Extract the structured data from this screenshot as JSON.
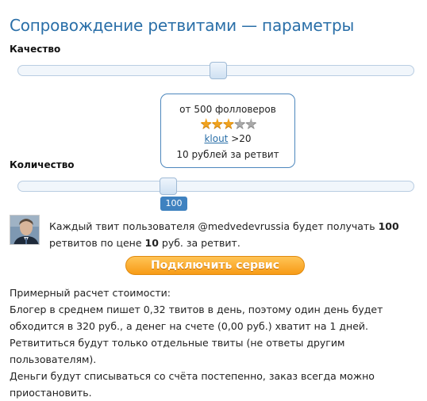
{
  "title": "Сопровождение ретвитами — параметры",
  "quality": {
    "label": "Качество",
    "slider_level": 0.5
  },
  "tooltip": {
    "followers": "от 500 фолловеров",
    "stars_total": 5,
    "stars_filled": 3,
    "klout_link": "klout",
    "klout_value": ">20",
    "price": "10 рублей за ретвит"
  },
  "quantity": {
    "label": "Количество",
    "value_badge": "100"
  },
  "description": {
    "text1": "Каждый твит пользователя @medvedevrussia будет получать ",
    "count": "100",
    "text2": "ретвитов по цене ",
    "price": "10",
    "text3": " руб. за ретвит."
  },
  "connect_button": "Подключить сервис",
  "estimate": {
    "line1": "Примерный расчет стоимости:",
    "line2": "Блогер в среднем пишет 0,32 твитов в день, поэтому один день будет",
    "line3": "обходится в 320 руб., а денег на счете (0,00 руб.) хватит на 1 дней.",
    "line4": "Ретвититься будут только отдельные твиты (не ответы другим пользователям).",
    "line5": "Деньги будут списываться со счёта постепенно, заказ всегда можно",
    "line6": "приостановить."
  },
  "colors": {
    "title": "#2a6fa8",
    "tooltip_border": "#4d87bd",
    "badge": "#3f82c0",
    "button": "#f79b16",
    "star_on": "#f0a21e",
    "star_off": "#a9a9a9"
  }
}
